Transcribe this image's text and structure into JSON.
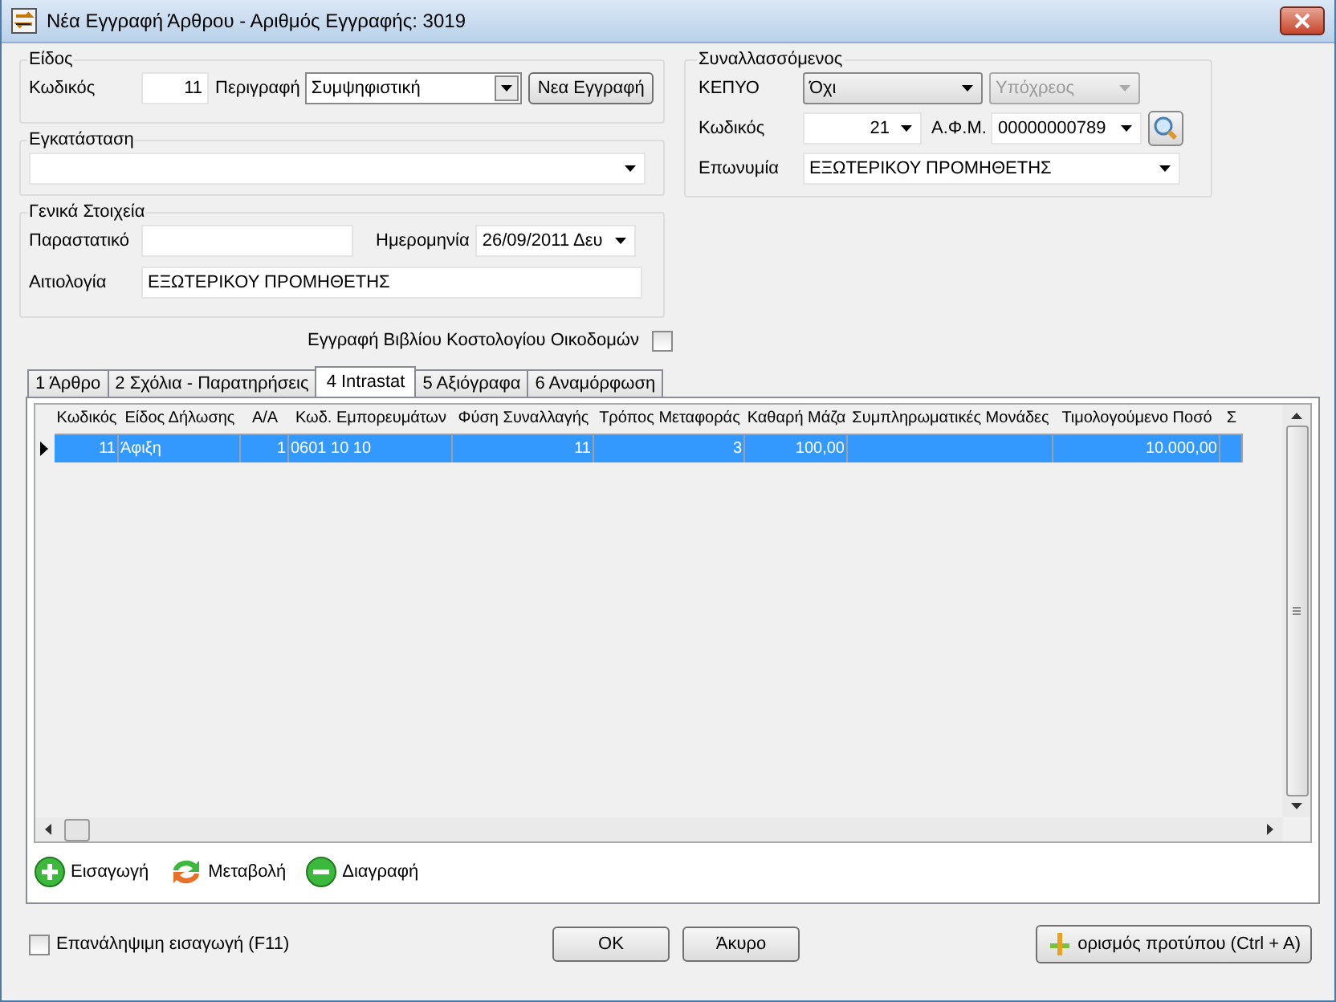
{
  "window": {
    "title": "Νέα Εγγραφή Άρθρου - Αριθμός Εγγραφής: 3019"
  },
  "eidos": {
    "title": "Είδος",
    "code_label": "Κωδικός",
    "code": "11",
    "desc_label": "Περιγραφή",
    "desc": "Συμψηφιστική",
    "new_button": "Νεα Εγγραφή"
  },
  "egkatastasi": {
    "title": "Εγκατάσταση"
  },
  "general": {
    "title": "Γενικά Στοιχεία",
    "doc_label": "Παραστατικό",
    "date_label": "Ημερομηνία",
    "date": "26/09/2011 Δευ",
    "reason_label": "Αιτιολογία",
    "reason": "ΕΞΩΤΕΡΙΚΟΥ ΠΡΟΜΗΘΕΤΗΣ"
  },
  "partner": {
    "title": "Συναλλασσόμενος",
    "kepyo_label": "ΚΕΠΥΟ",
    "kepyo": "Όχι",
    "obligated": "Υπόχρεος",
    "obligated_disabled": true,
    "code_label": "Κωδικός",
    "code": "21",
    "afm_label": "Α.Φ.Μ.",
    "afm": "00000000789",
    "name_label": "Επωνυμία",
    "name": "ΕΞΩΤΕΡΙΚΟΥ ΠΡΟΜΗΘΕΤΗΣ"
  },
  "cost_book": {
    "label": "Εγγραφή Βιβλίου Κοστολογίου Οικοδομών",
    "checked": false
  },
  "tabs": [
    {
      "label": "1 Άρθρο",
      "selected": false
    },
    {
      "label": "2 Σχόλια - Παρατηρήσεις",
      "selected": false
    },
    {
      "label": "4 Intrastat",
      "selected": true
    },
    {
      "label": "5 Αξιόγραφα",
      "selected": false
    },
    {
      "label": "6 Αναμόρφωση",
      "selected": false
    }
  ],
  "table": {
    "columns": [
      "Κωδικός",
      "Είδος Δήλωσης",
      "Α/Α",
      "Κωδ. Εμπορευμάτων",
      "Φύση Συναλλαγής",
      "Τρόπος Μεταφοράς",
      "Καθαρή Μάζα",
      "Συμπληρωματικές Μονάδες",
      "Τιμολογούμενο Ποσό",
      "Σ"
    ],
    "rows": [
      {
        "selected": true,
        "cells": [
          "11",
          "Άφιξη",
          "1",
          "0601 10 10",
          "11",
          "3",
          "100,00",
          "",
          "10.000,00",
          ""
        ]
      }
    ]
  },
  "actions": [
    {
      "kind": "add",
      "label": "Εισαγωγή"
    },
    {
      "kind": "edit",
      "label": "Μεταβολή"
    },
    {
      "kind": "delete",
      "label": "Διαγραφή"
    }
  ],
  "repeat": {
    "label": "Επανάληψιμη εισαγωγή (F11)",
    "checked": false
  },
  "buttons": [
    {
      "label": "OK"
    },
    {
      "label": "Άκυρο"
    }
  ],
  "template_button": "ορισμός προτύπου (Ctrl + A)"
}
